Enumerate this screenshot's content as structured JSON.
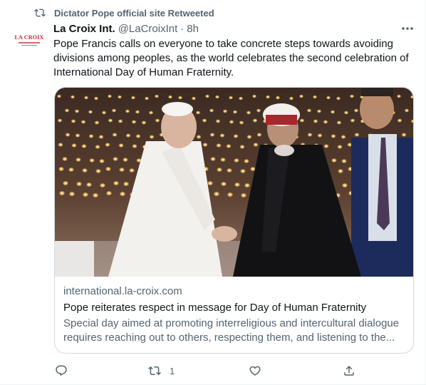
{
  "social_context": {
    "text": "Dictator Pope official site Retweeted",
    "icon": "retweet-icon"
  },
  "author": {
    "name": "La Croix Int.",
    "handle": "@LaCroixInt",
    "separator": "·",
    "time": "8h",
    "avatar_text": "LA CROIX"
  },
  "tweet": {
    "text": "Pope Francis calls on everyone to take concrete steps towards avoiding divisions among peoples, as the world celebrates the second celebration of International Day of Human Fraternity."
  },
  "card": {
    "domain": "international.la-croix.com",
    "title": "Pope reiterates respect in message for Day of Human Fraternity",
    "description": "Special day aimed at promoting interreligious and intercultural dialogue requires reaching out to others, respecting them, and listening to the..."
  },
  "actions": {
    "reply": {
      "icon": "reply-icon",
      "count": ""
    },
    "retweet": {
      "icon": "retweet-icon",
      "count": "1"
    },
    "like": {
      "icon": "heart-icon",
      "count": ""
    },
    "share": {
      "icon": "share-icon",
      "count": ""
    }
  },
  "colors": {
    "secondary_text": "#536471",
    "primary_text": "#0f1419",
    "border": "#cfd9de",
    "brand_red": "#c4262e"
  }
}
